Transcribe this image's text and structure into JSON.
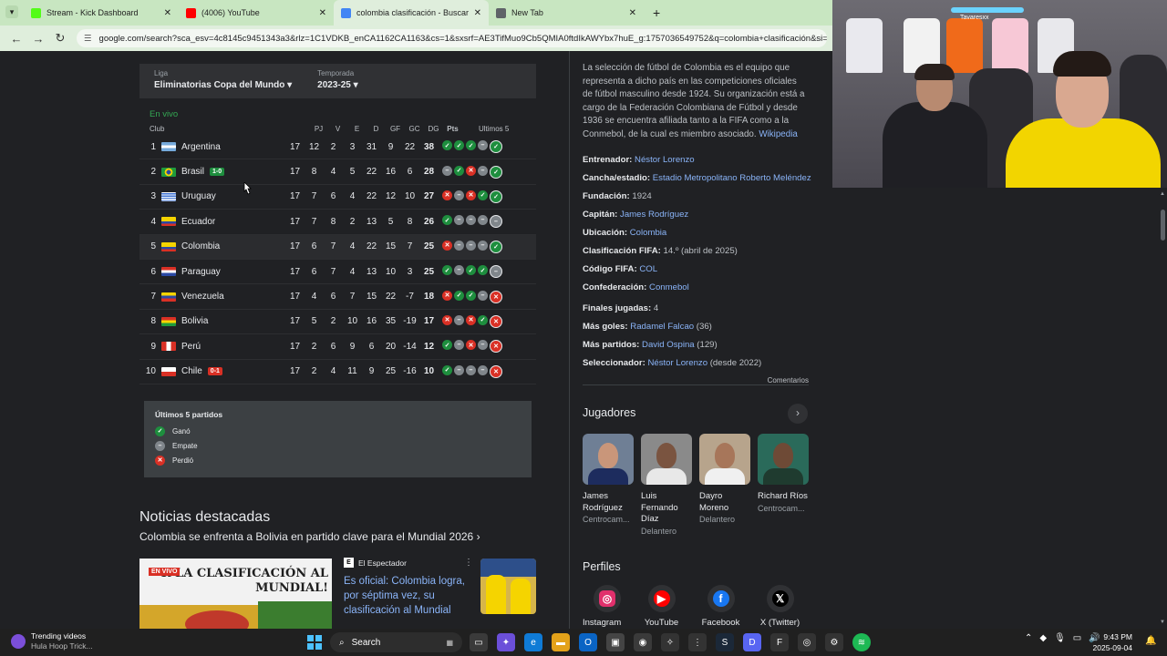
{
  "browser": {
    "tabs": [
      {
        "title": "Stream - Kick Dashboard",
        "favicon_color": "#53fc18",
        "active": false
      },
      {
        "title": "(4006) YouTube",
        "favicon_color": "#ff0000",
        "active": false
      },
      {
        "title": "colombia clasificación - Buscar",
        "favicon_color": "#4285f4",
        "active": true
      },
      {
        "title": "New Tab",
        "favicon_color": "#5f6368",
        "active": false
      }
    ],
    "new_tab_label": "+",
    "url": "google.com/search?sca_esv=4c8145c9451343a3&rlz=1C1VDKB_enCA1162CA1163&cs=1&sxsrf=AE3TifMuo9Cb5QMIA0ftdIkAWYbx7huE_g:1757036549752&q=colombia+clasificación&si=AMgyJEu"
  },
  "standings": {
    "league_label": "Liga",
    "league_value": "Eliminatorias Copa del Mundo",
    "season_label": "Temporada",
    "season_value": "2023-25",
    "live_label": "En vivo",
    "headers": {
      "club": "Club",
      "pj": "PJ",
      "v": "V",
      "e": "E",
      "d": "D",
      "gf": "GF",
      "gc": "GC",
      "dg": "DG",
      "pts": "Pts",
      "last5": "Ultimos 5"
    },
    "rows": [
      {
        "pos": "1",
        "club": "Argentina",
        "flag": "arg",
        "live": "",
        "pj": "17",
        "v": "12",
        "e": "2",
        "d": "3",
        "gf": "31",
        "gc": "9",
        "dg": "22",
        "pts": "38",
        "last5": [
          "W",
          "W",
          "W",
          "D",
          "W"
        ]
      },
      {
        "pos": "2",
        "club": "Brasil",
        "flag": "bra",
        "live": "1-0",
        "live_color": "green",
        "pj": "17",
        "v": "8",
        "e": "4",
        "d": "5",
        "gf": "22",
        "gc": "16",
        "dg": "6",
        "pts": "28",
        "last5": [
          "D",
          "W",
          "L",
          "D",
          "W"
        ]
      },
      {
        "pos": "3",
        "club": "Uruguay",
        "flag": "uru",
        "live": "",
        "pj": "17",
        "v": "7",
        "e": "6",
        "d": "4",
        "gf": "22",
        "gc": "12",
        "dg": "10",
        "pts": "27",
        "last5": [
          "L",
          "D",
          "L",
          "W",
          "W"
        ]
      },
      {
        "pos": "4",
        "club": "Ecuador",
        "flag": "ecu",
        "live": "",
        "pj": "17",
        "v": "7",
        "e": "8",
        "d": "2",
        "gf": "13",
        "gc": "5",
        "dg": "8",
        "pts": "26",
        "last5": [
          "W",
          "D",
          "D",
          "D",
          "D"
        ]
      },
      {
        "pos": "5",
        "club": "Colombia",
        "flag": "col",
        "live": "",
        "pj": "17",
        "v": "6",
        "e": "7",
        "d": "4",
        "gf": "22",
        "gc": "15",
        "dg": "7",
        "pts": "25",
        "last5": [
          "L",
          "D",
          "D",
          "D",
          "W"
        ],
        "highlight": true
      },
      {
        "pos": "6",
        "club": "Paraguay",
        "flag": "par",
        "live": "",
        "pj": "17",
        "v": "6",
        "e": "7",
        "d": "4",
        "gf": "13",
        "gc": "10",
        "dg": "3",
        "pts": "25",
        "last5": [
          "W",
          "D",
          "W",
          "W",
          "D"
        ]
      },
      {
        "pos": "7",
        "club": "Venezuela",
        "flag": "ven",
        "live": "",
        "pj": "17",
        "v": "4",
        "e": "6",
        "d": "7",
        "gf": "15",
        "gc": "22",
        "dg": "-7",
        "pts": "18",
        "last5": [
          "L",
          "W",
          "W",
          "D",
          "L"
        ]
      },
      {
        "pos": "8",
        "club": "Bolivia",
        "flag": "bol",
        "live": "",
        "pj": "17",
        "v": "5",
        "e": "2",
        "d": "10",
        "gf": "16",
        "gc": "35",
        "dg": "-19",
        "pts": "17",
        "last5": [
          "L",
          "D",
          "L",
          "W",
          "L"
        ]
      },
      {
        "pos": "9",
        "club": "Perú",
        "flag": "per",
        "live": "",
        "pj": "17",
        "v": "2",
        "e": "6",
        "d": "9",
        "gf": "6",
        "gc": "20",
        "dg": "-14",
        "pts": "12",
        "last5": [
          "W",
          "D",
          "L",
          "D",
          "L"
        ]
      },
      {
        "pos": "10",
        "club": "Chile",
        "flag": "chi",
        "live": "0-1",
        "live_color": "red",
        "pj": "17",
        "v": "2",
        "e": "4",
        "d": "11",
        "gf": "9",
        "gc": "25",
        "dg": "-16",
        "pts": "10",
        "last5": [
          "W",
          "D",
          "D",
          "D",
          "L"
        ]
      }
    ],
    "legend": {
      "title": "Últimos 5 partidos",
      "won": "Ganó",
      "draw": "Empate",
      "lost": "Perdió"
    }
  },
  "news": {
    "heading": "Noticias destacadas",
    "subheading": "Colombia se enfrenta a Bolivia en partido clave para el Mundial 2026",
    "image_tag": "EN VIVO",
    "image_headline": "R LA CLASIFICACIÓN AL MUNDIAL!",
    "source": "El Espectador",
    "source_initial": "E",
    "title": "Es oficial: Colombia logra, por séptima vez, su clasificación al Mundial"
  },
  "knowledge_panel": {
    "description": "La selección de fútbol de Colombia es el equipo que representa a dicho país en las competiciones oficiales de fútbol masculino desde 1924. Su organización está a cargo de la Federación Colombiana de Fútbol y desde 1936 se encuentra afiliada tanto a la FIFA como a la Conmebol, de la cual es miembro asociado.",
    "wiki_link": "Wikipedia",
    "facts": [
      {
        "label": "Entrenador:",
        "value": "Néstor Lorenzo",
        "link": true,
        "suffix": ""
      },
      {
        "label": "Cancha/estadio:",
        "value": "Estadio Metropolitano Roberto Meléndez",
        "link": true,
        "suffix": ""
      },
      {
        "label": "Fundación:",
        "value": "1924",
        "link": false,
        "suffix": ""
      },
      {
        "label": "Capitán:",
        "value": "James Rodríguez",
        "link": true,
        "suffix": ""
      },
      {
        "label": "Ubicación:",
        "value": "Colombia",
        "link": true,
        "suffix": ""
      },
      {
        "label": "Clasificación FIFA:",
        "value": "14.º (abril de 2025)",
        "link": false,
        "suffix": ""
      },
      {
        "label": "Código FIFA:",
        "value": "COL",
        "link": true,
        "suffix": ""
      },
      {
        "label": "Confederación:",
        "value": "Conmebol",
        "link": true,
        "suffix": ""
      },
      {
        "label": "Finales jugadas:",
        "value": "4",
        "link": false,
        "suffix": "",
        "gap": true
      },
      {
        "label": "Más goles:",
        "value": "Radamel Falcao",
        "link": true,
        "suffix": " (36)"
      },
      {
        "label": "Más partidos:",
        "value": "David Ospina",
        "link": true,
        "suffix": " (129)"
      },
      {
        "label": "Seleccionador:",
        "value": "Néstor Lorenzo",
        "link": true,
        "suffix": " (desde 2022)"
      }
    ],
    "comments_label": "Comentarios",
    "players_title": "Jugadores",
    "players": [
      {
        "name": "James Rodríguez",
        "role": "Centrocam...",
        "bg": "#6f7f95",
        "shirt": "#1d2c5e",
        "skin": "#c9967a"
      },
      {
        "name": "Luis Fernando Díaz",
        "role": "Delantero",
        "bg": "#8a8a8a",
        "shirt": "#e8e8e8",
        "skin": "#7a5440"
      },
      {
        "name": "Dayro Moreno",
        "role": "Delantero",
        "bg": "#b7a48c",
        "shirt": "#f0f0f0",
        "skin": "#a7765a"
      },
      {
        "name": "Richard Ríos",
        "role": "Centrocam...",
        "bg": "#2a6a5a",
        "shirt": "#1f3b2f",
        "skin": "#6e4a36"
      }
    ],
    "profiles_title": "Perfiles",
    "profiles": [
      {
        "label": "Instagram",
        "icon": "instagram-icon",
        "color": "#e1306c"
      },
      {
        "label": "YouTube",
        "icon": "youtube-icon",
        "color": "#ff0000"
      },
      {
        "label": "Facebook",
        "icon": "facebook-icon",
        "color": "#1877f2"
      },
      {
        "label": "X (Twitter)",
        "icon": "x-icon",
        "color": "#ffffff"
      }
    ]
  },
  "webcam": {
    "handle": "Tavaresxx"
  },
  "taskbar": {
    "trending_title": "Trending videos",
    "trending_sub": "Hula Hoop Trick...",
    "search_label": "Search",
    "time": "9:43 PM",
    "date": "2025-09-04"
  }
}
